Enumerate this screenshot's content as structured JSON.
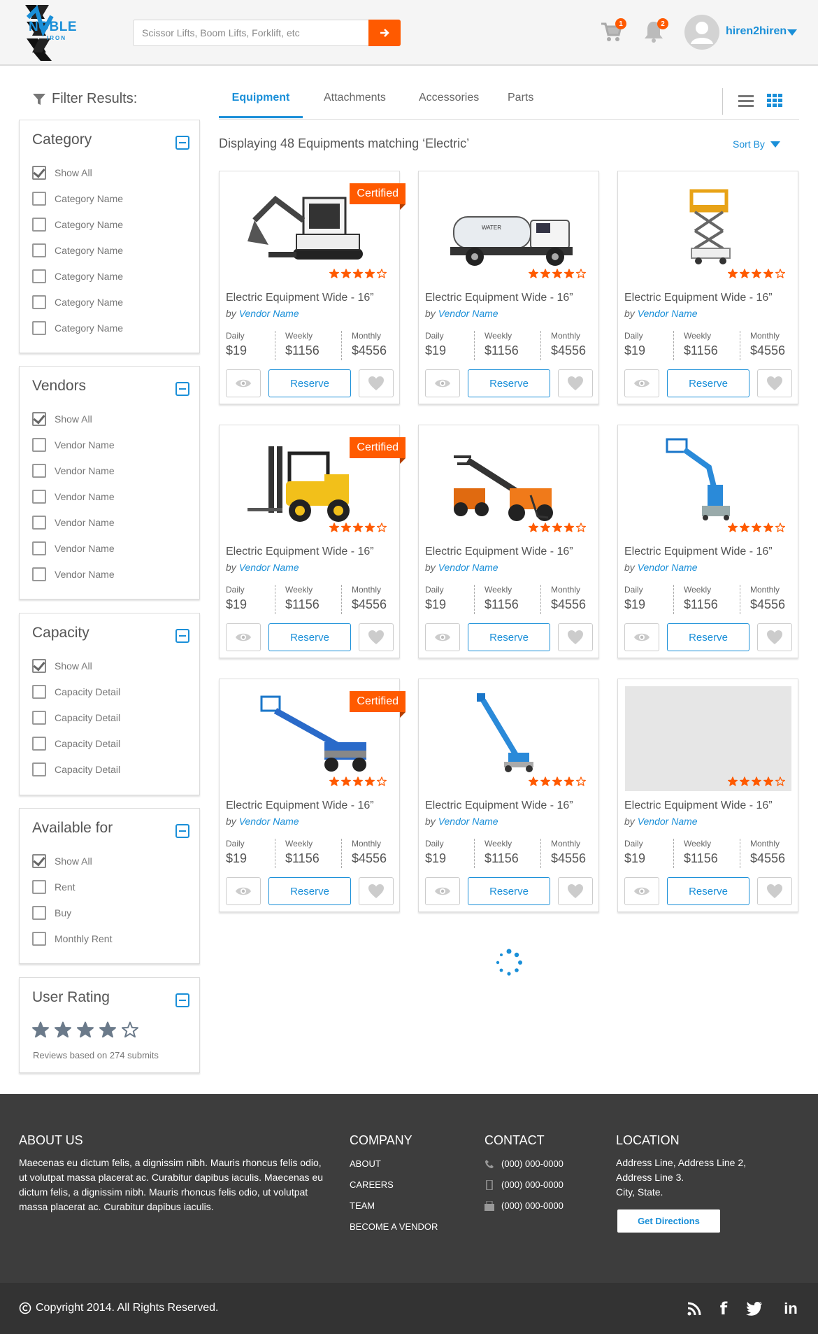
{
  "header": {
    "brand": "NOBLE",
    "brand_sub": "IRON",
    "search_placeholder": "Scissor Lifts, Boom Lifts, Forklift, etc",
    "cart_count": "1",
    "notif_count": "2",
    "username": "hiren2hiren"
  },
  "sidebar": {
    "filter_title": "Filter Results:",
    "panels": [
      {
        "title": "Category",
        "options": [
          "Show All",
          "Category Name",
          "Category Name",
          "Category Name",
          "Category Name",
          "Category Name",
          "Category Name"
        ]
      },
      {
        "title": "Vendors",
        "options": [
          "Show All",
          "Vendor Name",
          "Vendor Name",
          "Vendor Name",
          "Vendor Name",
          "Vendor Name",
          "Vendor Name"
        ]
      },
      {
        "title": "Capacity",
        "options": [
          "Show All",
          "Capacity Detail",
          "Capacity Detail",
          "Capacity Detail",
          "Capacity Detail"
        ]
      },
      {
        "title": "Available for",
        "options": [
          "Show All",
          "Rent",
          "Buy",
          "Monthly Rent"
        ]
      }
    ],
    "rating": {
      "title": "User Rating",
      "stars": 4,
      "reviews": "Reviews based on 274 submits"
    }
  },
  "main": {
    "tabs": [
      "Equipment",
      "Attachments",
      "Accessories",
      "Parts"
    ],
    "display_text": "Displaying 48 Equipments matching ‘Electric’",
    "sort_label": "Sort By",
    "card_labels": {
      "daily": "Daily",
      "weekly": "Weekly",
      "monthly": "Monthly",
      "reserve": "Reserve",
      "by": "by",
      "certified": "Certified"
    },
    "cards": [
      {
        "title": "Electric Equipment Wide - 16”",
        "vendor": "Vendor Name",
        "daily": "$19",
        "weekly": "$1156",
        "monthly": "$4556",
        "certified": true,
        "image": "mini-excavator",
        "rating": 4
      },
      {
        "title": "Electric Equipment Wide - 16”",
        "vendor": "Vendor Name",
        "daily": "$19",
        "weekly": "$1156",
        "monthly": "$4556",
        "certified": false,
        "image": "water-truck",
        "rating": 4
      },
      {
        "title": "Electric Equipment Wide - 16”",
        "vendor": "Vendor Name",
        "daily": "$19",
        "weekly": "$1156",
        "monthly": "$4556",
        "certified": false,
        "image": "scissor-lift",
        "rating": 4
      },
      {
        "title": "Electric Equipment Wide - 16”",
        "vendor": "Vendor Name",
        "daily": "$19",
        "weekly": "$1156",
        "monthly": "$4556",
        "certified": true,
        "image": "forklift",
        "rating": 4
      },
      {
        "title": "Electric Equipment Wide - 16”",
        "vendor": "Vendor Name",
        "daily": "$19",
        "weekly": "$1156",
        "monthly": "$4556",
        "certified": false,
        "image": "telehandler",
        "rating": 4
      },
      {
        "title": "Electric Equipment Wide - 16”",
        "vendor": "Vendor Name",
        "daily": "$19",
        "weekly": "$1156",
        "monthly": "$4556",
        "certified": false,
        "image": "articulating-boom",
        "rating": 4
      },
      {
        "title": "Electric Equipment Wide - 16”",
        "vendor": "Vendor Name",
        "daily": "$19",
        "weekly": "$1156",
        "monthly": "$4556",
        "certified": true,
        "image": "boom-lift",
        "rating": 4
      },
      {
        "title": "Electric Equipment Wide - 16”",
        "vendor": "Vendor Name",
        "daily": "$19",
        "weekly": "$1156",
        "monthly": "$4556",
        "certified": false,
        "image": "telescopic-boom",
        "rating": 4
      },
      {
        "title": "Electric Equipment Wide - 16”",
        "vendor": "Vendor Name",
        "daily": "$19",
        "weekly": "$1156",
        "monthly": "$4556",
        "certified": false,
        "image": "placeholder",
        "rating": 4
      }
    ]
  },
  "footer": {
    "about_title": "ABOUT US",
    "about_text": "Maecenas eu dictum felis, a dignissim nibh. Mauris rhoncus felis odio, ut volutpat massa placerat ac. Curabitur dapibus iaculis. Maecenas eu dictum felis, a dignissim nibh. Mauris rhoncus felis odio, ut volutpat massa placerat ac. Curabitur dapibus iaculis.",
    "company_title": "COMPANY",
    "company_links": [
      "ABOUT",
      "CAREERS",
      "TEAM",
      "BECOME A VENDOR"
    ],
    "contact_title": "CONTACT",
    "contacts": [
      "(000) 000-0000",
      "(000) 000-0000",
      "(000) 000-0000"
    ],
    "location_title": "LOCATION",
    "address": [
      "Address Line, Address Line 2,",
      "Address Line 3.",
      "City, State."
    ],
    "directions": "Get Directions",
    "copyright": "Copyright 2014. All Rights Reserved.",
    "social": [
      "rss-icon",
      "facebook-icon",
      "twitter-icon",
      "linkedin-icon"
    ]
  },
  "colors": {
    "accent": "#1a8fd8",
    "brand_orange": "#ff5a00",
    "footer_bg": "#3d3d3d",
    "bottom_bar": "#333333"
  }
}
